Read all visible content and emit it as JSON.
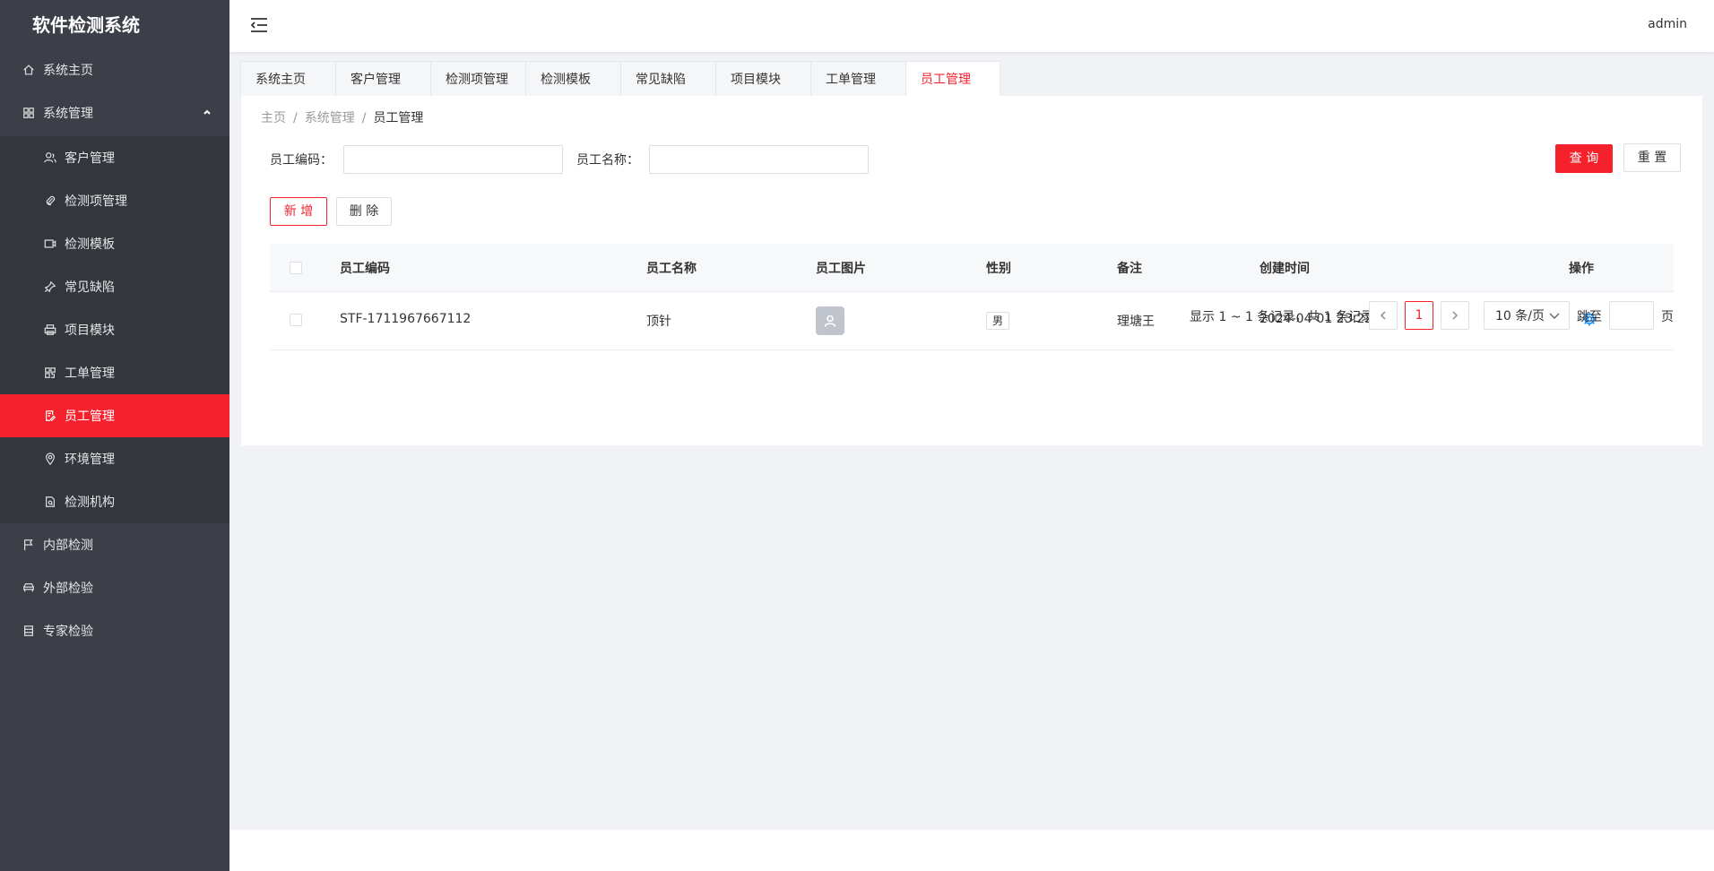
{
  "app": {
    "title": "软件检测系统",
    "user": "admin"
  },
  "sidebar": {
    "home": "系统主页",
    "system": "系统管理",
    "sub": [
      {
        "label": "客户管理"
      },
      {
        "label": "检测项管理"
      },
      {
        "label": "检测模板"
      },
      {
        "label": "常见缺陷"
      },
      {
        "label": "项目模块"
      },
      {
        "label": "工单管理"
      },
      {
        "label": "员工管理"
      },
      {
        "label": "环境管理"
      },
      {
        "label": "检测机构"
      }
    ],
    "internal": "内部检测",
    "external": "外部检验",
    "expert": "专家检验"
  },
  "tabs": [
    "系统主页",
    "客户管理",
    "检测项管理",
    "检测模板",
    "常见缺陷",
    "项目模块",
    "工单管理",
    "员工管理"
  ],
  "breadcrumb": {
    "home": "主页",
    "sep": "/",
    "section": "系统管理",
    "current": "员工管理"
  },
  "search": {
    "code_label": "员工编码：",
    "name_label": "员工名称：",
    "query": "查 询",
    "reset": "重 置"
  },
  "actions": {
    "add": "新 增",
    "delete": "删 除"
  },
  "table": {
    "headers": [
      "员工编码",
      "员工名称",
      "员工图片",
      "性别",
      "备注",
      "创建时间",
      "操作"
    ],
    "rows": [
      {
        "code": "STF-1711967667112",
        "name": "顶针",
        "gender": "男",
        "note": "理塘王",
        "created": "2024-04-01 23:22:02"
      }
    ]
  },
  "pagination": {
    "summary": "显示 1 ~ 1 条记录，共 1 条记录",
    "current": "1",
    "page_size": "10 条/页",
    "jump_label": "跳至",
    "page_unit": "页"
  },
  "colors": {
    "accent": "#f5222d",
    "sidebar": "#3c3f48",
    "link": "#1890ff"
  }
}
